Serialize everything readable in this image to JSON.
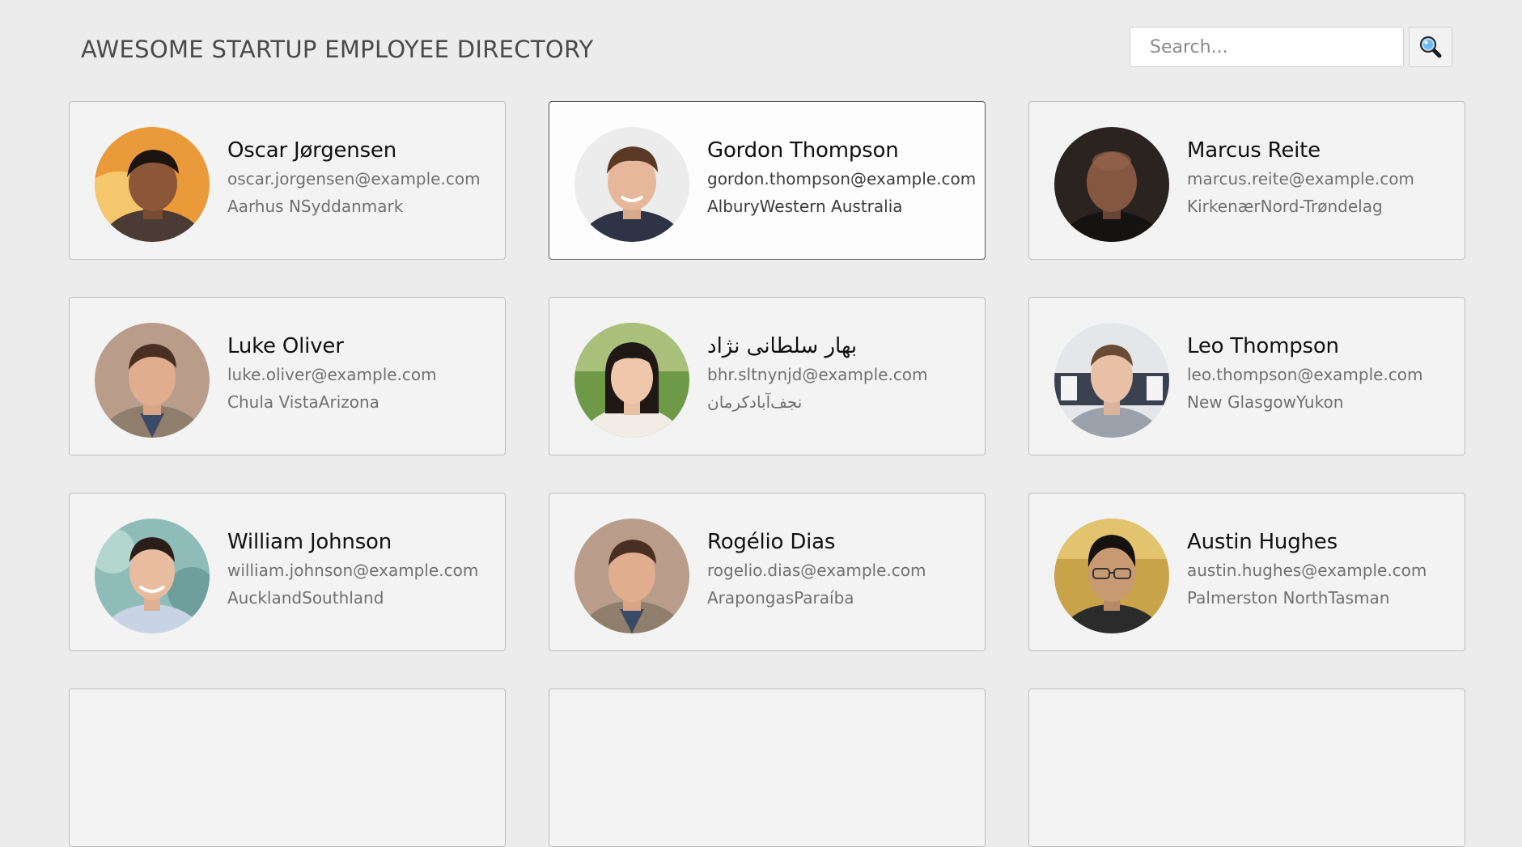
{
  "header": {
    "title": "AWESOME STARTUP EMPLOYEE DIRECTORY",
    "search_placeholder": "Search...",
    "search_value": "",
    "search_icon": "magnifying-glass-icon"
  },
  "employees": [
    {
      "name": "Oscar Jørgensen",
      "email": "oscar.jorgensen@example.com",
      "location": "Aarhus NSyddanmark"
    },
    {
      "name": "Gordon Thompson",
      "email": "gordon.thompson@example.com",
      "location": "AlburyWestern Australia"
    },
    {
      "name": "Marcus Reite",
      "email": "marcus.reite@example.com",
      "location": "KirkenærNord-Trøndelag"
    },
    {
      "name": "Luke Oliver",
      "email": "luke.oliver@example.com",
      "location": "Chula VistaArizona"
    },
    {
      "name": "بهار سلطانی نژاد",
      "email": "bhr.sltnynjd@example.com",
      "location": "نجف‌آبادکرمان"
    },
    {
      "name": "Leo Thompson",
      "email": "leo.thompson@example.com",
      "location": "New GlasgowYukon"
    },
    {
      "name": "William Johnson",
      "email": "william.johnson@example.com",
      "location": "AucklandSouthland"
    },
    {
      "name": "Rogélio Dias",
      "email": "rogelio.dias@example.com",
      "location": "ArapongasParaíba"
    },
    {
      "name": "Austin Hughes",
      "email": "austin.hughes@example.com",
      "location": "Palmerston NorthTasman"
    },
    {
      "name": "",
      "email": "",
      "location": ""
    },
    {
      "name": "",
      "email": "",
      "location": ""
    },
    {
      "name": "",
      "email": "",
      "location": ""
    }
  ],
  "colors": {
    "page_background": "#ececec",
    "card_background": "#f3f3f3",
    "card_border": "#bdbdbd",
    "active_card_background": "#fdfdfd",
    "active_card_border": "#555555",
    "name_text": "#111111",
    "detail_text": "#707070"
  }
}
